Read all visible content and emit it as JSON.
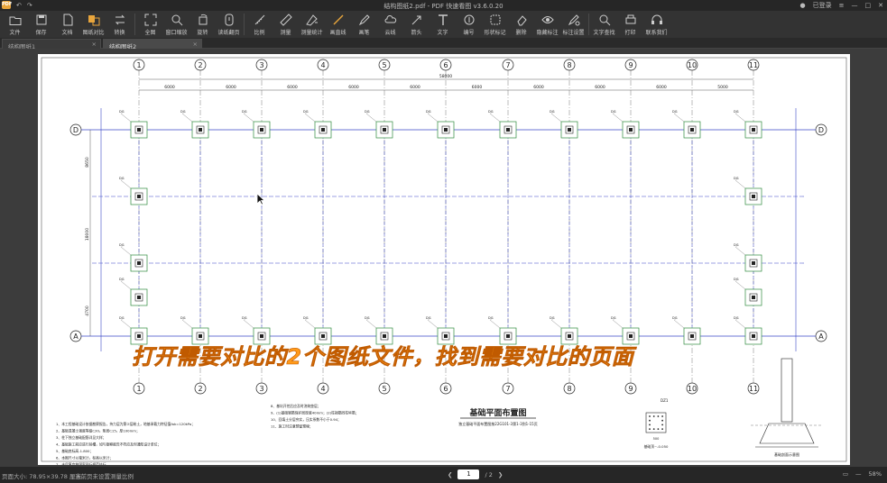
{
  "app": {
    "title": "结构图纸2.pdf - PDF 快速看图 v3.6.0.20",
    "login": "已登录",
    "logo": "PDF"
  },
  "toolbar": [
    {
      "label": "文件",
      "icon": "folder-icon"
    },
    {
      "label": "保存",
      "icon": "save-icon"
    },
    {
      "label": "文档",
      "icon": "document-icon"
    },
    {
      "label": "图纸对比",
      "icon": "compare-icon"
    },
    {
      "label": "转换",
      "icon": "convert-icon"
    },
    {
      "label": "全图",
      "icon": "fit-page-icon"
    },
    {
      "label": "窗口缩放",
      "icon": "zoom-window-icon"
    },
    {
      "label": "旋转",
      "icon": "rotate-icon"
    },
    {
      "label": "读纸翻页",
      "icon": "page-turn-icon"
    },
    {
      "label": "比例",
      "icon": "scale-icon"
    },
    {
      "label": "测量",
      "icon": "measure-icon"
    },
    {
      "label": "测量统计",
      "icon": "measure-stats-icon"
    },
    {
      "label": "画直线",
      "icon": "line-icon"
    },
    {
      "label": "画笔",
      "icon": "pen-icon"
    },
    {
      "label": "云线",
      "icon": "cloud-icon"
    },
    {
      "label": "箭头",
      "icon": "arrow-icon"
    },
    {
      "label": "文字",
      "icon": "text-icon"
    },
    {
      "label": "编号",
      "icon": "number-icon"
    },
    {
      "label": "形状标记",
      "icon": "shape-icon"
    },
    {
      "label": "删除",
      "icon": "eraser-icon"
    },
    {
      "label": "隐藏标注",
      "icon": "eye-icon"
    },
    {
      "label": "标注设置",
      "icon": "annotation-settings-icon"
    },
    {
      "label": "文字查找",
      "icon": "search-icon"
    },
    {
      "label": "打印",
      "icon": "print-icon"
    },
    {
      "label": "联系我们",
      "icon": "headset-icon"
    }
  ],
  "tabs": [
    {
      "label": "结构图纸1",
      "active": false
    },
    {
      "label": "结构图纸2",
      "active": true
    }
  ],
  "drawing": {
    "title": "基础平面布置图",
    "subtitle": "独立基础平面布置图按22G101-3第1-3到1-15页",
    "detail_title": "基础剖面示意图",
    "column_labels": [
      "1",
      "2",
      "3",
      "4",
      "5",
      "6",
      "7",
      "8",
      "9",
      "10",
      "11"
    ],
    "row_labels": [
      "D",
      "A"
    ],
    "dims_top": [
      "5000",
      "6000",
      "6000",
      "6000",
      "6000",
      "6000",
      "6000",
      "6000",
      "6000",
      "6000",
      "5000"
    ],
    "total_dim": "58000",
    "left_dims": [
      "8650",
      "18000",
      "4700"
    ],
    "notes_left": [
      "1、本工程基础设计依据勘察报告，持力层为第②层粉土，地基承载力特征值fak=120kPa；",
      "2、基础混凝土强度等级C30，垫层C15，厚100mm；",
      "3、柱下独立基础配筋详见大样；",
      "4、基础施工前应进行验槽，如与勘察报告不符应及时通知设计单位；",
      "5、基础底标高-1.800；",
      "6、本图尺寸以毫米计，标高以米计；",
      "7、未尽事宜按国家现行规范执行。"
    ],
    "notes_right": [
      "8、基坑开挖后应及时浇筑垫层；",
      "9、(1)基础钢筋保护层厚度40mm；(2)柱插筋同柱纵筋；",
      "10、回填土分层夯实，压实系数不小于0.94；",
      "11、施工时注意预留预埋；"
    ],
    "dz_label": "DZ1",
    "dz_level": "基础顶~-0.050",
    "dz_dim": "500"
  },
  "caption": "打开需要对比的2个图纸文件，找到需要对比的页面",
  "status": {
    "page_size": "页面大小: 78.95×39.78 厘米",
    "scale_text": "当前页未设置测量比例",
    "current_page": "1",
    "total_pages": "/ 2",
    "zoom": "58%"
  },
  "colors": {
    "accent": "#ff9a1a",
    "grid_blue": "#3a46c8",
    "footing_green": "#2e8b3e"
  }
}
